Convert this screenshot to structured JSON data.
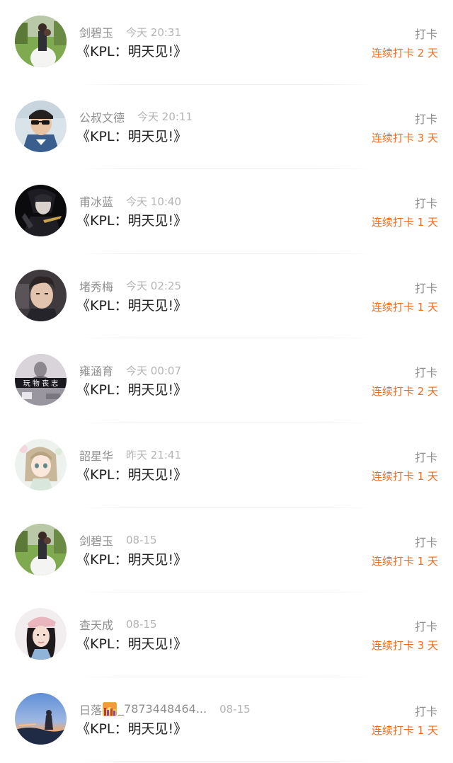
{
  "rows": [
    {
      "name": "剑碧玉",
      "time": "今天 20:31",
      "title": "《KPL：明天见!》",
      "action": "打卡",
      "streak": "连续打卡 2 天",
      "avatar": "avatar-wedding-couple-icon"
    },
    {
      "name": "公叔文德",
      "time": "今天 20:11",
      "title": "《KPL：明天见!》",
      "action": "打卡",
      "streak": "连续打卡 3 天",
      "avatar": "avatar-sunglasses-man-icon"
    },
    {
      "name": "甫冰蓝",
      "time": "今天 10:40",
      "title": "《KPL：明天见!》",
      "action": "打卡",
      "streak": "连续打卡 1 天",
      "avatar": "avatar-dark-portrait-icon"
    },
    {
      "name": "堵秀梅",
      "time": "今天 02:25",
      "title": "《KPL：明天见!》",
      "action": "打卡",
      "streak": "连续打卡 1 天",
      "avatar": "avatar-young-man-icon"
    },
    {
      "name": "雍涵育",
      "time": "今天 00:07",
      "title": "《KPL：明天见!》",
      "action": "打卡",
      "streak": "连续打卡 2 天",
      "avatar": "avatar-text-banner-icon",
      "avatar_text": "玩 物 丧 志"
    },
    {
      "name": "韶星华",
      "time": "昨天 21:41",
      "title": "《KPL：明天见!》",
      "action": "打卡",
      "streak": "连续打卡 1 天",
      "avatar": "avatar-anime-girl-icon"
    },
    {
      "name": "剑碧玉",
      "time": "08-15",
      "title": "《KPL：明天见!》",
      "action": "打卡",
      "streak": "连续打卡 1 天",
      "avatar": "avatar-wedding-couple-icon"
    },
    {
      "name": "查天成",
      "time": "08-15",
      "title": "《KPL：明天见!》",
      "action": "打卡",
      "streak": "连续打卡 3 天",
      "avatar": "avatar-girl-beret-icon"
    },
    {
      "name_prefix": "日落",
      "name_suffix": "_7873448464...",
      "emoji": "sunset-city-emoji",
      "time": "08-15",
      "title": "《KPL：明天见!》",
      "action": "打卡",
      "streak": "连续打卡 1 天",
      "avatar": "avatar-sunset-sky-icon"
    }
  ],
  "colors": {
    "name": "#8e8e8e",
    "time": "#b4b4b4",
    "title": "#222222",
    "streak": "#f26b1d"
  }
}
